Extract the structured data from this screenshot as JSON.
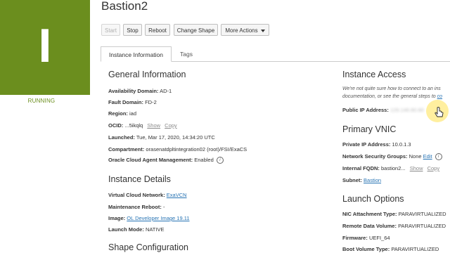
{
  "instance": {
    "letter": "I",
    "state": "RUNNING",
    "title": "Bastion2"
  },
  "toolbar": {
    "start": "Start",
    "stop": "Stop",
    "reboot": "Reboot",
    "change_shape": "Change Shape",
    "more_actions": "More Actions"
  },
  "tabs": {
    "instance_info": "Instance Information",
    "tags": "Tags"
  },
  "general": {
    "title": "General Information",
    "ad_label": "Availability Domain:",
    "ad_value": "AD-1",
    "fd_label": "Fault Domain:",
    "fd_value": "FD-2",
    "region_label": "Region:",
    "region_value": "iad",
    "ocid_label": "OCID:",
    "ocid_value": "...5ikqlq",
    "show": "Show",
    "copy": "Copy",
    "launched_label": "Launched:",
    "launched_value": "Tue, Mar 17, 2020, 14:34:20 UTC",
    "compartment_label": "Compartment:",
    "compartment_value": "orasenatdpltintegration02 (root)/FSI/ExaCS",
    "agent_label": "Oracle Cloud Agent Management:",
    "agent_value": "Enabled"
  },
  "details": {
    "title": "Instance Details",
    "vcn_label": "Virtual Cloud Network:",
    "vcn_value": "ExaVCN",
    "maint_label": "Maintenance Reboot:",
    "maint_value": "-",
    "image_label": "Image:",
    "image_value": "OL Developer Image 19.11",
    "launch_mode_label": "Launch Mode:",
    "launch_mode_value": "NATIVE"
  },
  "shape": {
    "title": "Shape Configuration"
  },
  "access": {
    "title": "Instance Access",
    "note_line1": "We're not quite sure how to connect to an ins",
    "note_line2_a": "documentation, or see the general steps to ",
    "note_line2_link": "co",
    "public_ip_label": "Public IP Address:",
    "public_ip_value": "129.146.80.80"
  },
  "vnic": {
    "title": "Primary VNIC",
    "private_ip_label": "Private IP Address:",
    "private_ip_value": "10.0.1.3",
    "nsg_label": "Network Security Groups:",
    "nsg_value": "None",
    "nsg_edit": "Edit",
    "fqdn_label": "Internal FQDN:",
    "fqdn_value": "bastion2...",
    "show": "Show",
    "copy": "Copy",
    "subnet_label": "Subnet:",
    "subnet_value": "Bastion"
  },
  "launch_options": {
    "title": "Launch Options",
    "nic_label": "NIC Attachment Type:",
    "nic_value": "PARAVIRTUALIZED",
    "remote_label": "Remote Data Volume:",
    "remote_value": "PARAVIRTUALIZED",
    "firmware_label": "Firmware:",
    "firmware_value": "UEFI_64",
    "boot_label": "Boot Volume Type:",
    "boot_value": "PARAVIRTUALIZED"
  },
  "colors": {
    "accent_green": "#6b8e1e",
    "link_blue": "#2874b4"
  }
}
